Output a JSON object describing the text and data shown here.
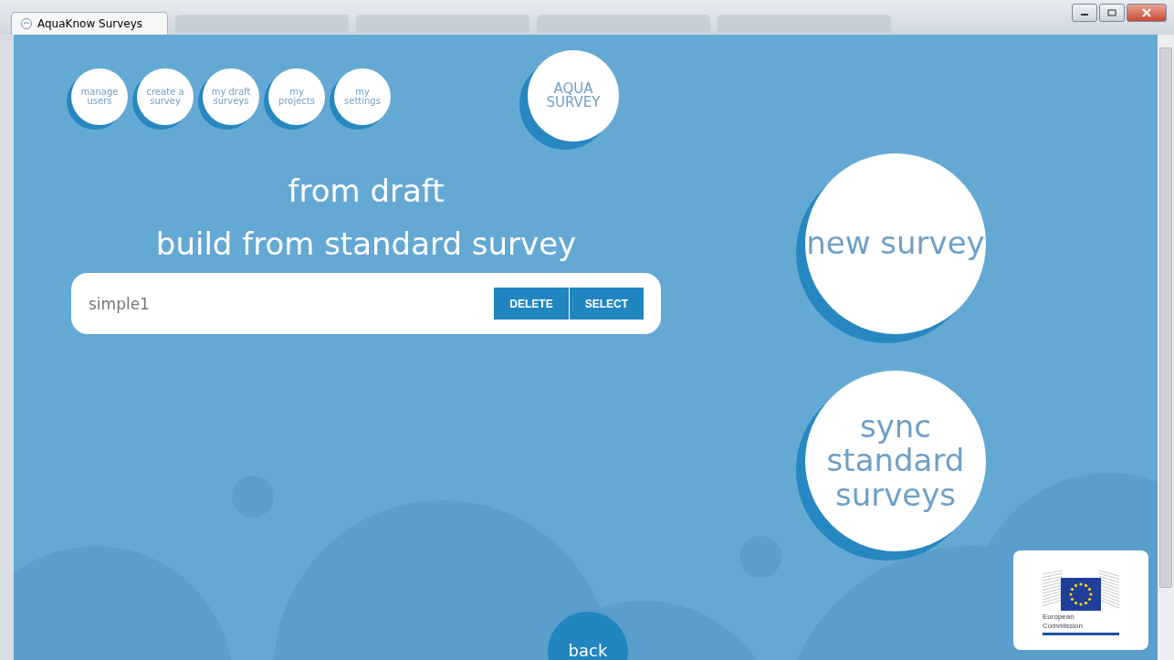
{
  "window": {
    "title": "AquaKnow Surveys"
  },
  "nav": [
    {
      "label": "manage\nusers"
    },
    {
      "label": "create a\nsurvey"
    },
    {
      "label": "my draft\nsurveys"
    },
    {
      "label": "my\nprojects"
    },
    {
      "label": "my\nsettings"
    }
  ],
  "logo": "AQUA\nSURVEY",
  "headings": [
    "from draft",
    "build from standard survey"
  ],
  "drafts": [
    {
      "name": "simple1",
      "buttons": [
        "DELETE",
        "SELECT"
      ]
    }
  ],
  "actions": [
    "new survey",
    "sync\nstandard\nsurveys"
  ],
  "back": "back",
  "partner_logo": {
    "caption": "European\nCommission"
  }
}
